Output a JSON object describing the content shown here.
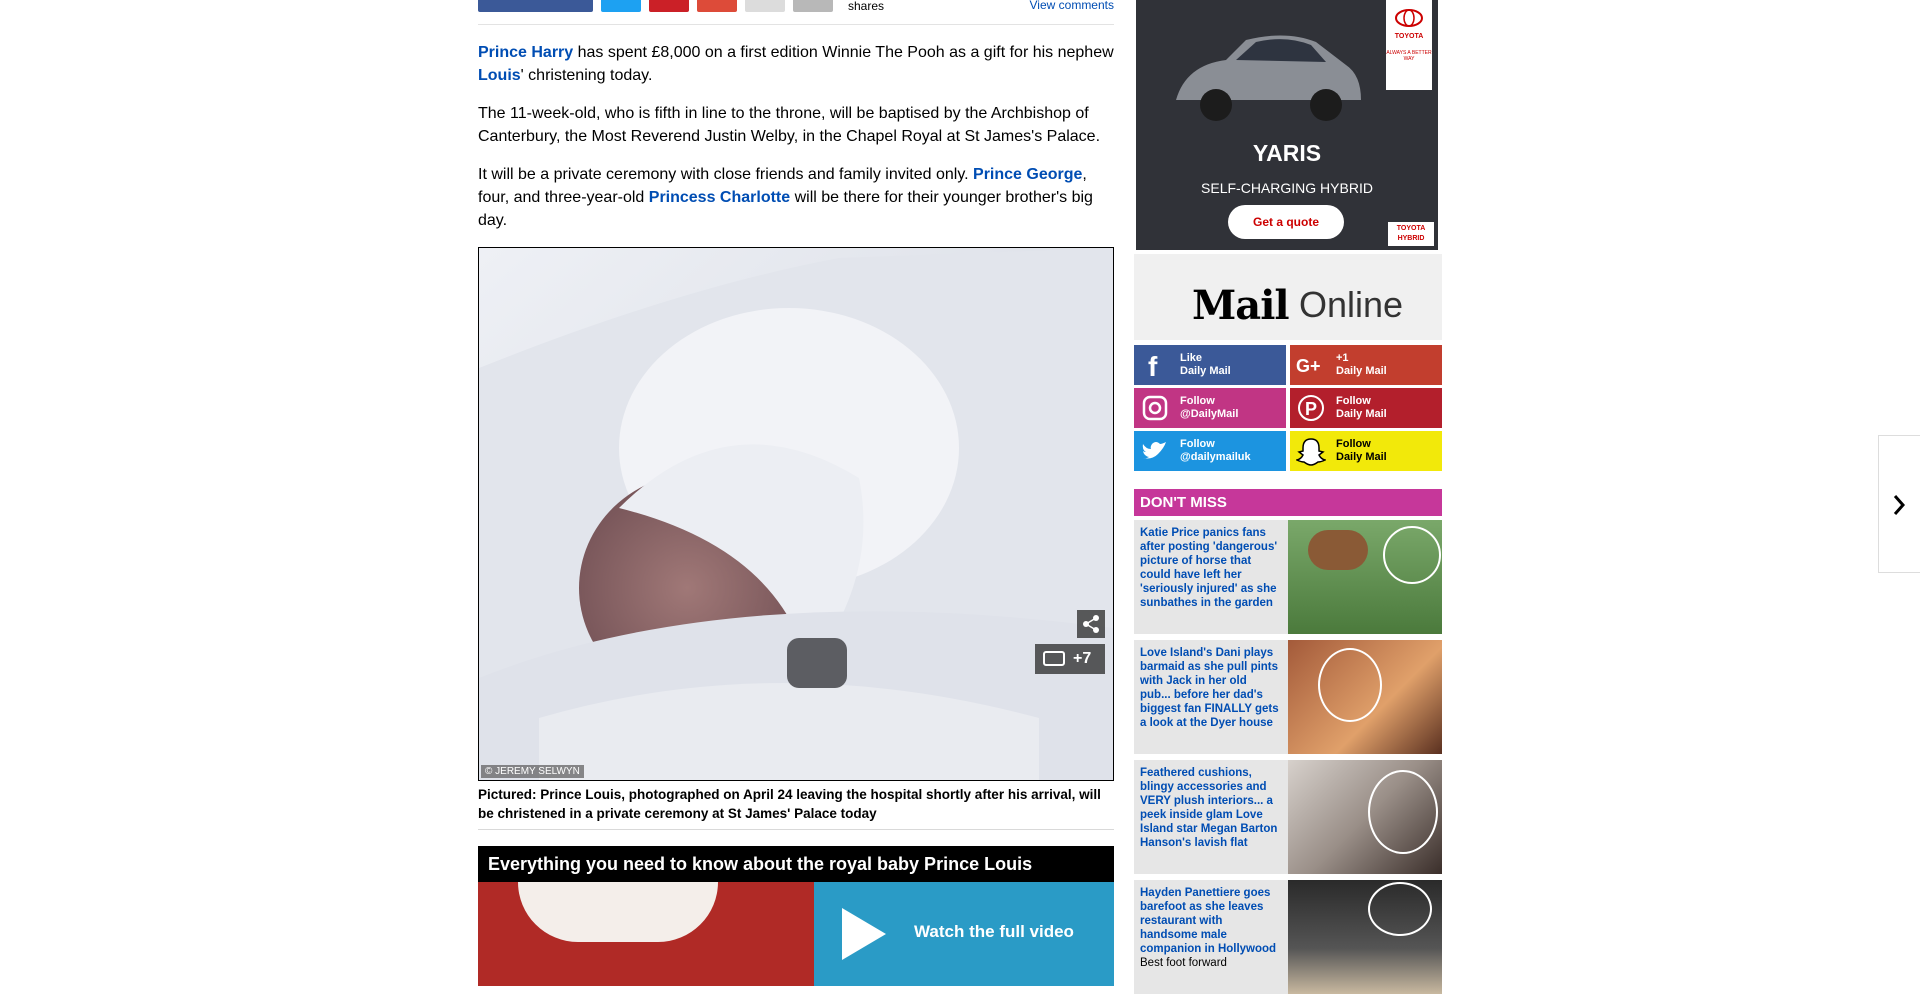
{
  "share": {
    "count_label": "shares",
    "view_comments": "View comments"
  },
  "article": {
    "p1": {
      "link1": "Prince Harry",
      "t1": " has spent £8,000 on a first edition Winnie The Pooh as a gift for his nephew ",
      "link2": "Louis",
      "t2": "' christening today."
    },
    "p2": "The 11-week-old, who is fifth in line to the throne, will be baptised by the Archbishop of Canterbury, the Most Reverend Justin Welby, in the Chapel Royal at St James's Palace.",
    "p3": {
      "t1": "It will be a private ceremony with close friends and family invited only. ",
      "link1": "Prince George",
      "t2": ", four, and three-year-old ",
      "link2": "Princess Charlotte",
      "t3": " will be there for their younger brother's big day."
    },
    "image": {
      "credit": "© JEREMY SELWYN",
      "gallery_count": "+7"
    },
    "caption": "Pictured: Prince Louis, photographed on April 24 leaving the hospital shortly after his arrival, will be christened in a private ceremony at St James' Palace today",
    "video": {
      "title": "Everything you need to know about the royal baby Prince Louis",
      "cta": "Watch the full video"
    }
  },
  "ad": {
    "brand": "TOYOTA",
    "tagline": "ALWAYS A BETTER WAY",
    "model": "YARIS",
    "subtitle": "SELF-CHARGING HYBRID",
    "cta": "Get a quote",
    "badge_top": "TOYOTA",
    "badge_bottom": "HYBRID"
  },
  "logo": {
    "bold": "Mail",
    "light": "Online"
  },
  "social": [
    {
      "line1": "Like",
      "line2": "Daily Mail",
      "color": "#3b5998",
      "icon": "facebook-icon"
    },
    {
      "line1": "+1",
      "line2": "Daily Mail",
      "color": "#c23e2e",
      "icon": "googleplus-icon"
    },
    {
      "line1": "Follow",
      "line2": "@DailyMail",
      "color": "#c13584",
      "icon": "instagram-icon"
    },
    {
      "line1": "Follow",
      "line2": "Daily Mail",
      "color": "#b31f2c",
      "icon": "pinterest-icon"
    },
    {
      "line1": "Follow",
      "line2": "@dailymailuk",
      "color": "#1c94e0",
      "icon": "twitter-icon"
    },
    {
      "line1": "Follow",
      "line2": "Daily Mail",
      "color": "#f2e90a",
      "icon": "snapchat-icon"
    }
  ],
  "dont_miss": {
    "heading": "DON'T MISS",
    "items": [
      {
        "text": "Katie Price panics fans after posting 'dangerous' picture of horse that could have left her 'seriously injured' as she sunbathes in the garden",
        "sub": ""
      },
      {
        "text": "Love Island's Dani plays barmaid as she pull pints with Jack in her old pub... before her dad's biggest fan FINALLY gets a look at the Dyer house",
        "sub": ""
      },
      {
        "text": "Feathered cushions, blingy accessories and VERY plush interiors... a peek inside glam Love Island star Megan Barton Hanson's lavish flat",
        "sub": ""
      },
      {
        "text": "Hayden Panettiere goes barefoot as she leaves restaurant with handsome male companion in Hollywood",
        "sub": "Best foot forward"
      }
    ]
  }
}
